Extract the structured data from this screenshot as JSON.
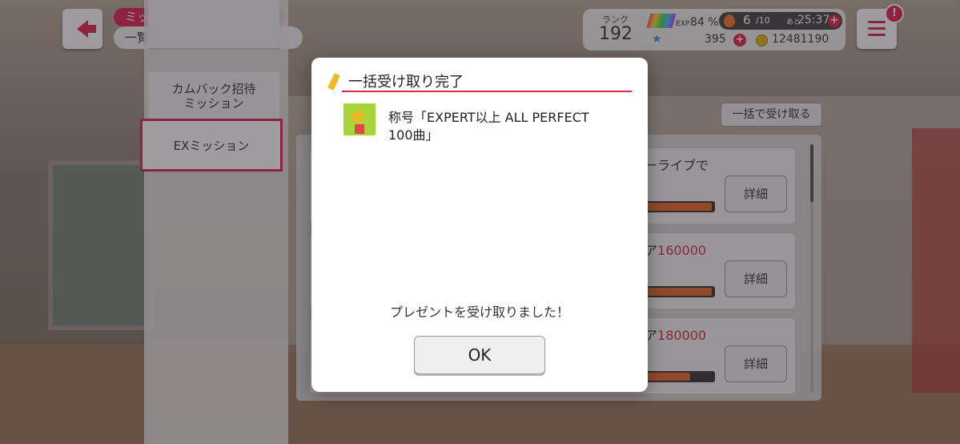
{
  "header": {
    "breadcrumb_top": "ミッション",
    "breadcrumb_sub": "一覧"
  },
  "sidebar": {
    "items": [
      {
        "label": "カムバック招待\nミッション"
      },
      {
        "label": "EXミッション"
      }
    ]
  },
  "status": {
    "rank_label": "ランク",
    "rank": "192",
    "exp_label": "EXP",
    "exp_percent": "84 %",
    "stamina": "6",
    "stamina_max": "/10",
    "recover_label": "あと",
    "recover_time": "25:37",
    "star_gems": "395",
    "coins": "12481190"
  },
  "missions": {
    "claim_all": "一括で受け取る",
    "items": [
      {
        "text_prefix": "ーライブで",
        "text_red": "",
        "progress": 0.95,
        "detail": "詳細"
      },
      {
        "text_prefix": "ア",
        "text_red": "160000",
        "progress": 0.95,
        "detail": "詳細"
      },
      {
        "text_prefix": "ア",
        "text_red": "180000",
        "progress": 0.65,
        "detail": "詳細"
      }
    ]
  },
  "dialog": {
    "title": "一括受け取り完了",
    "reward_line1": "称号「EXPERT以上 ALL PERFECT",
    "reward_line2": "100曲」",
    "message": "プレゼントを受け取りました！",
    "ok": "OK"
  },
  "colors": {
    "accent": "#e0244f",
    "progress": "#e8682a"
  }
}
